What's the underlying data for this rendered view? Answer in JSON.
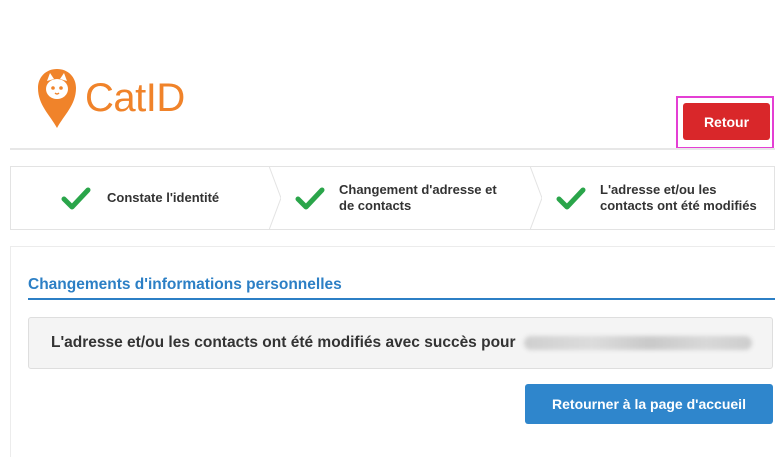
{
  "header": {
    "brand": "CatID",
    "back_button_label": "Retour"
  },
  "colors": {
    "brand_orange": "#f0832a",
    "back_button": "#d9272a",
    "primary_blue": "#2f86cc",
    "check_green": "#2aa54a",
    "highlight_outline": "#e43fd4"
  },
  "steps": [
    {
      "label": "Constate l'identité",
      "status": "done",
      "icon": "check-icon"
    },
    {
      "label_line1": "Changement d'adresse et",
      "label_line2": "de contacts",
      "status": "done",
      "icon": "check-icon"
    },
    {
      "label_line1": "L'adresse et/ou les",
      "label_line2": "contacts ont été modifiés",
      "status": "done",
      "icon": "check-icon"
    }
  ],
  "panel": {
    "title": "Changements d'informations personnelles",
    "message": "L'adresse et/ou les contacts ont été modifiés avec succès pour",
    "home_button_label": "Retourner à la page d'accueil"
  }
}
